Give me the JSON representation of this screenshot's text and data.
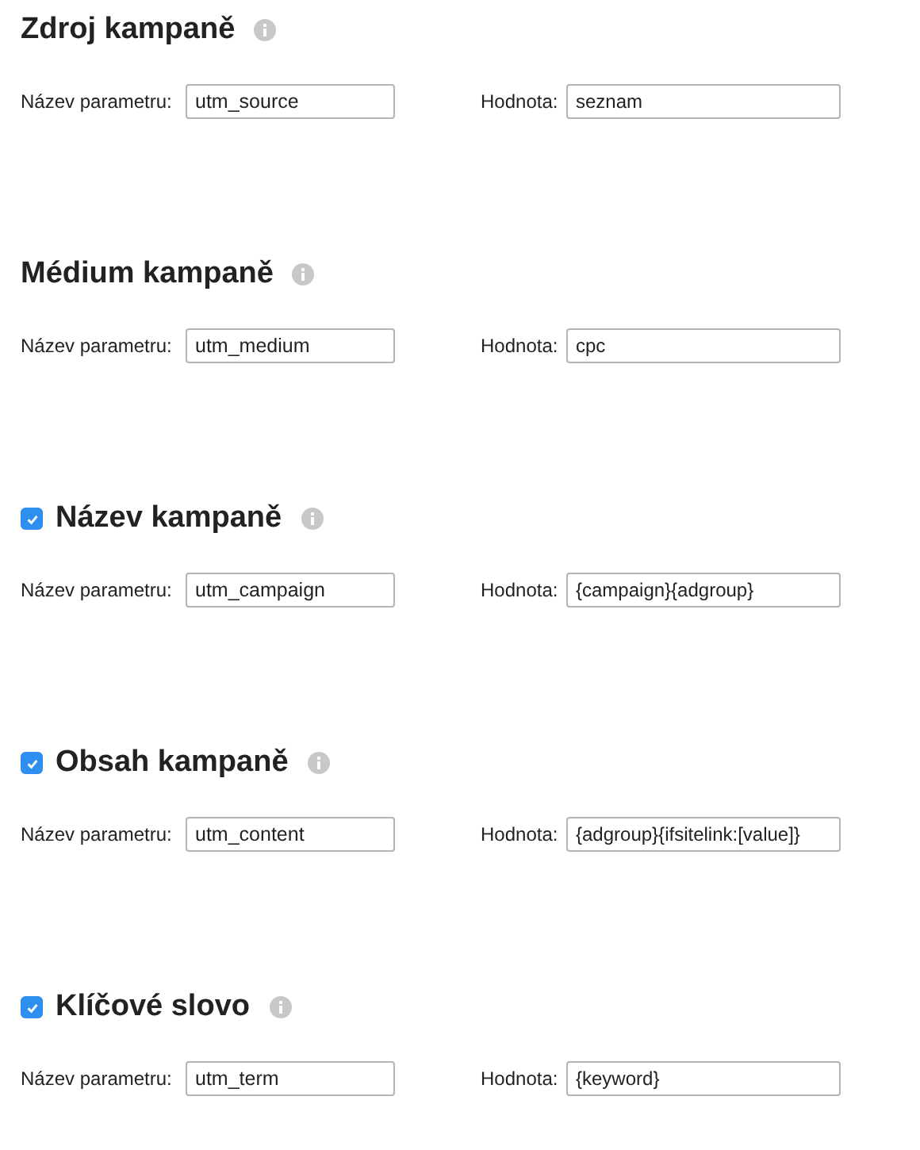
{
  "sections": [
    {
      "kind": "plain",
      "title": "Zdroj kampaně",
      "param_label": "Název parametru:",
      "param_value": "utm_source",
      "value_label": "Hodnota:",
      "value": "seznam"
    },
    {
      "kind": "plain",
      "title": "Médium kampaně",
      "param_label": "Název parametru:",
      "param_value": "utm_medium",
      "value_label": "Hodnota:",
      "value": "cpc"
    },
    {
      "kind": "toggle",
      "checked": true,
      "title": "Název kampaně",
      "param_label": "Název parametru:",
      "param_value": "utm_campaign",
      "value_label": "Hodnota:",
      "value": "{campaign}{adgroup}"
    },
    {
      "kind": "toggle",
      "checked": true,
      "title": "Obsah kampaně",
      "param_label": "Název parametru:",
      "param_value": "utm_content",
      "value_label": "Hodnota:",
      "value": "{adgroup}{ifsitelink:[value]}"
    },
    {
      "kind": "toggle",
      "checked": true,
      "title": "Klíčové slovo",
      "param_label": "Název parametru:",
      "param_value": "utm_term",
      "value_label": "Hodnota:",
      "value": "{keyword}"
    }
  ]
}
